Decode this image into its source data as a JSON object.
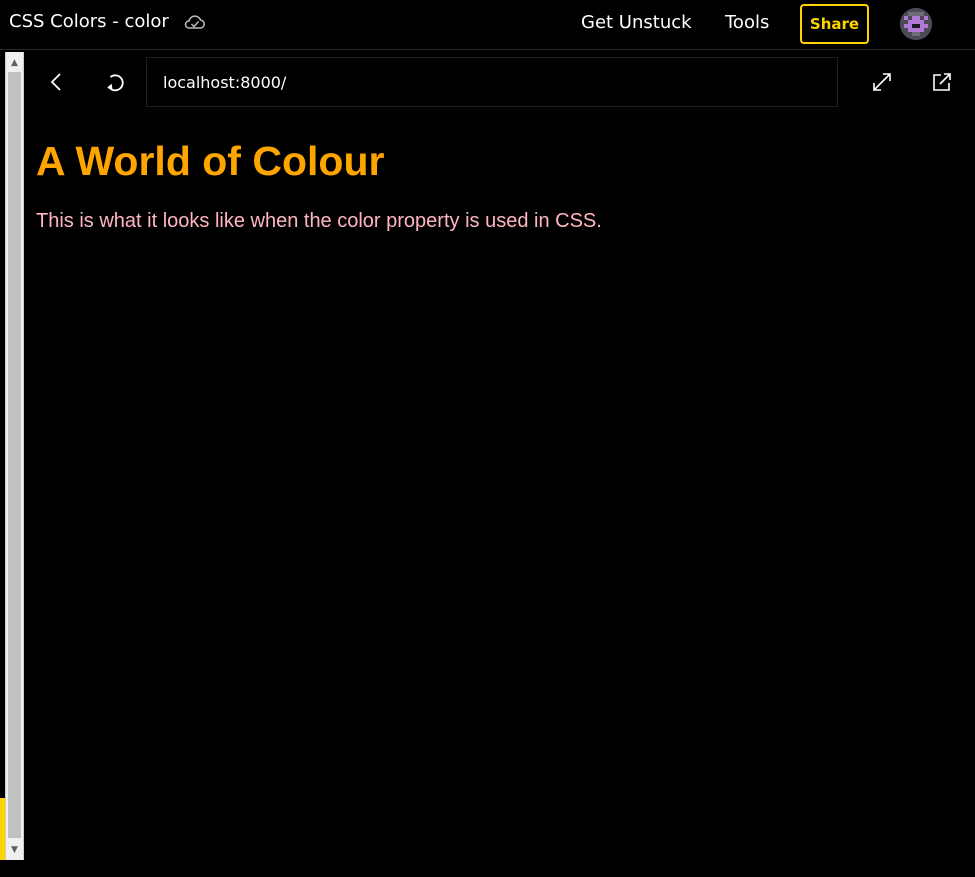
{
  "app": {
    "project_title": "CSS Colors - color",
    "cloud_icon": "cloud-check-icon",
    "nav": {
      "get_unstuck": "Get Unstuck",
      "tools": "Tools"
    },
    "share_label": "Share",
    "accent_color": "#ffd300",
    "avatar_icon": "pixel-avatar-icon"
  },
  "browser": {
    "back_icon": "chevron-left-icon",
    "refresh_icon": "refresh-icon",
    "url": "localhost:8000/",
    "expand_icon": "expand-icon",
    "external_icon": "external-link-icon"
  },
  "page": {
    "heading": "A World of Colour",
    "heading_color": "#ffa500",
    "paragraph": "This is what it looks like when the color property is used in CSS.",
    "paragraph_color": "#ffb6c1",
    "background_color": "#000000"
  }
}
